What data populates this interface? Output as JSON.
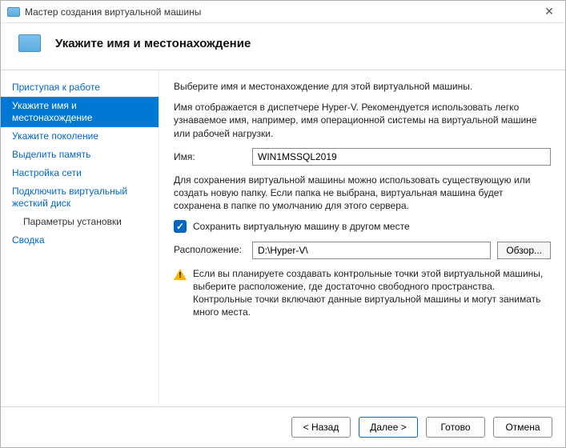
{
  "window": {
    "title": "Мастер создания виртуальной машины"
  },
  "header": {
    "title": "Укажите имя и местонахождение"
  },
  "sidebar": {
    "steps": [
      "Приступая к работе",
      "Укажите имя и местонахождение",
      "Укажите поколение",
      "Выделить память",
      "Настройка сети",
      "Подключить виртуальный жесткий диск",
      "Параметры установки",
      "Сводка"
    ],
    "active_index": 1,
    "sub_index": 6
  },
  "content": {
    "intro": "Выберите имя и местонахождение для этой виртуальной машины.",
    "name_help": "Имя отображается в диспетчере Hyper-V. Рекомендуется использовать легко узнаваемое имя, например, имя операционной системы на виртуальной машине или рабочей нагрузки.",
    "name_label": "Имя:",
    "name_value": "WIN1MSSQL2019",
    "folder_help": "Для сохранения виртуальной машины можно использовать существующую или создать новую папку. Если папка не выбрана, виртуальная машина будет сохранена в папке по умолчанию для этого сервера.",
    "store_checkbox_label": "Сохранить виртуальную машину в другом месте",
    "store_checked": true,
    "location_label": "Расположение:",
    "location_value": "D:\\Hyper-V\\",
    "browse_label": "Обзор...",
    "warning_text": "Если вы планируете создавать контрольные точки этой виртуальной машины, выберите расположение, где достаточно свободного пространства. Контрольные точки включают данные виртуальной машины и могут занимать много места."
  },
  "footer": {
    "back": "< Назад",
    "next": "Далее >",
    "finish": "Готово",
    "cancel": "Отмена"
  }
}
